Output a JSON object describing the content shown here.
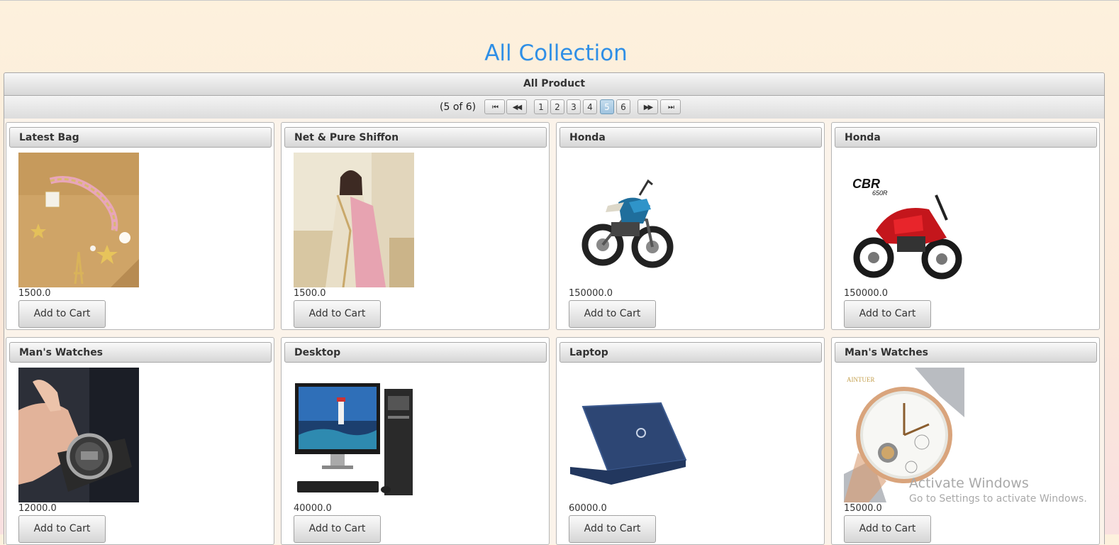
{
  "page": {
    "title": "All Collection"
  },
  "panel": {
    "header": "All Product"
  },
  "paginator": {
    "current_report": "(5 of 6)",
    "pages": [
      "1",
      "2",
      "3",
      "4",
      "5",
      "6"
    ],
    "active_page": "5",
    "first_icon": "first-page-icon",
    "prev_icon": "prev-page-icon",
    "next_icon": "next-page-icon",
    "last_icon": "last-page-icon"
  },
  "products": [
    {
      "name": "Latest Bag",
      "price": "1500.0",
      "button": "Add to Cart",
      "image": "bag-charm-bracelet"
    },
    {
      "name": "Net & Pure Shiffon",
      "price": "1500.0",
      "button": "Add to Cart",
      "image": "saree-woman"
    },
    {
      "name": "Honda",
      "price": "150000.0",
      "button": "Add to Cart",
      "image": "blue-motorbike"
    },
    {
      "name": "Honda",
      "price": "150000.0",
      "button": "Add to Cart",
      "image": "red-cbr-motorbike",
      "image_text": "CBR 650R"
    },
    {
      "name": "Man's Watches",
      "price": "12000.0",
      "button": "Add to Cart",
      "image": "wrist-watch-hand"
    },
    {
      "name": "Desktop",
      "price": "40000.0",
      "button": "Add to Cart",
      "image": "desktop-computer"
    },
    {
      "name": "Laptop",
      "price": "60000.0",
      "button": "Add to Cart",
      "image": "blue-laptop"
    },
    {
      "name": "Man's Watches",
      "price": "15000.0",
      "button": "Add to Cart",
      "image": "skeleton-watch",
      "image_text": "AINTUER"
    }
  ],
  "watermark": {
    "line1": "Activate Windows",
    "line2": "Go to Settings to activate Windows."
  }
}
